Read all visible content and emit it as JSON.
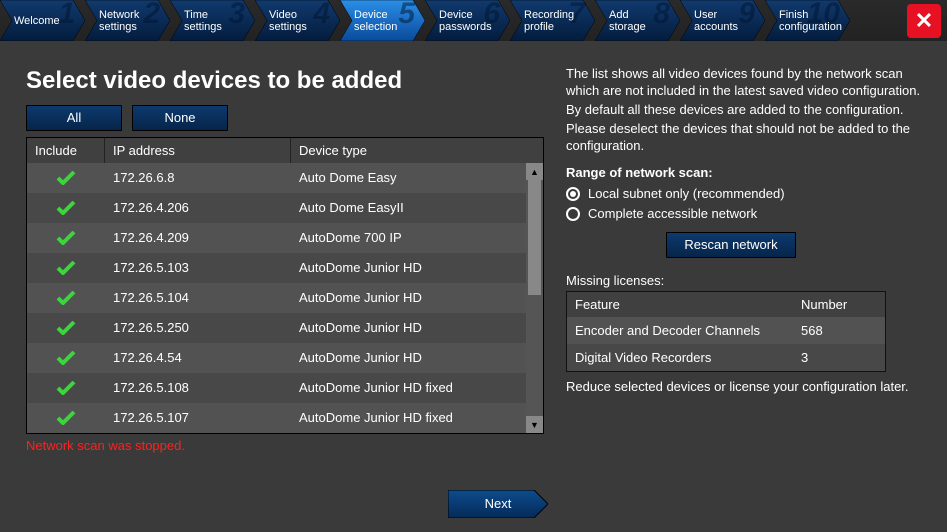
{
  "steps": [
    {
      "num": "1",
      "label": "Welcome"
    },
    {
      "num": "2",
      "label": "Network settings"
    },
    {
      "num": "3",
      "label": "Time settings"
    },
    {
      "num": "4",
      "label": "Video settings"
    },
    {
      "num": "5",
      "label": "Device selection"
    },
    {
      "num": "6",
      "label": "Device passwords"
    },
    {
      "num": "7",
      "label": "Recording profile"
    },
    {
      "num": "8",
      "label": "Add storage"
    },
    {
      "num": "9",
      "label": "User accounts"
    },
    {
      "num": "10",
      "label": "Finish configuration"
    }
  ],
  "current_step_index": 4,
  "title": "Select video devices to be added",
  "buttons": {
    "all": "All",
    "none": "None",
    "next": "Next",
    "rescan": "Rescan network"
  },
  "table": {
    "headers": {
      "include": "Include",
      "ip": "IP address",
      "type": "Device type"
    },
    "rows": [
      {
        "checked": true,
        "ip": "172.26.6.8",
        "type": "Auto Dome Easy"
      },
      {
        "checked": true,
        "ip": "172.26.4.206",
        "type": "Auto Dome EasyII"
      },
      {
        "checked": true,
        "ip": "172.26.4.209",
        "type": "AutoDome 700 IP"
      },
      {
        "checked": true,
        "ip": "172.26.5.103",
        "type": "AutoDome Junior HD"
      },
      {
        "checked": true,
        "ip": "172.26.5.104",
        "type": "AutoDome Junior HD"
      },
      {
        "checked": true,
        "ip": "172.26.5.250",
        "type": "AutoDome Junior HD"
      },
      {
        "checked": true,
        "ip": "172.26.4.54",
        "type": "AutoDome Junior HD"
      },
      {
        "checked": true,
        "ip": "172.26.5.108",
        "type": "AutoDome Junior HD fixed"
      },
      {
        "checked": true,
        "ip": "172.26.5.107",
        "type": "AutoDome Junior HD fixed"
      }
    ]
  },
  "status": "Network scan was stopped.",
  "help": {
    "line1": "The list shows all video devices found by the network scan which are not included in the latest saved video configuration.",
    "line2": "By default all these devices are added to the configuration.",
    "line3": "Please deselect the devices that should not be added to the configuration."
  },
  "scan": {
    "heading": "Range of network scan:",
    "opt1": "Local subnet only (recommended)",
    "opt2": "Complete accessible network",
    "selected": 0
  },
  "licenses": {
    "heading": "Missing licenses:",
    "cols": {
      "feature": "Feature",
      "number": "Number"
    },
    "rows": [
      {
        "feature": "Encoder and Decoder Channels",
        "number": "568"
      },
      {
        "feature": "Digital Video Recorders",
        "number": "3"
      }
    ],
    "note": "Reduce selected devices or license your configuration later."
  }
}
